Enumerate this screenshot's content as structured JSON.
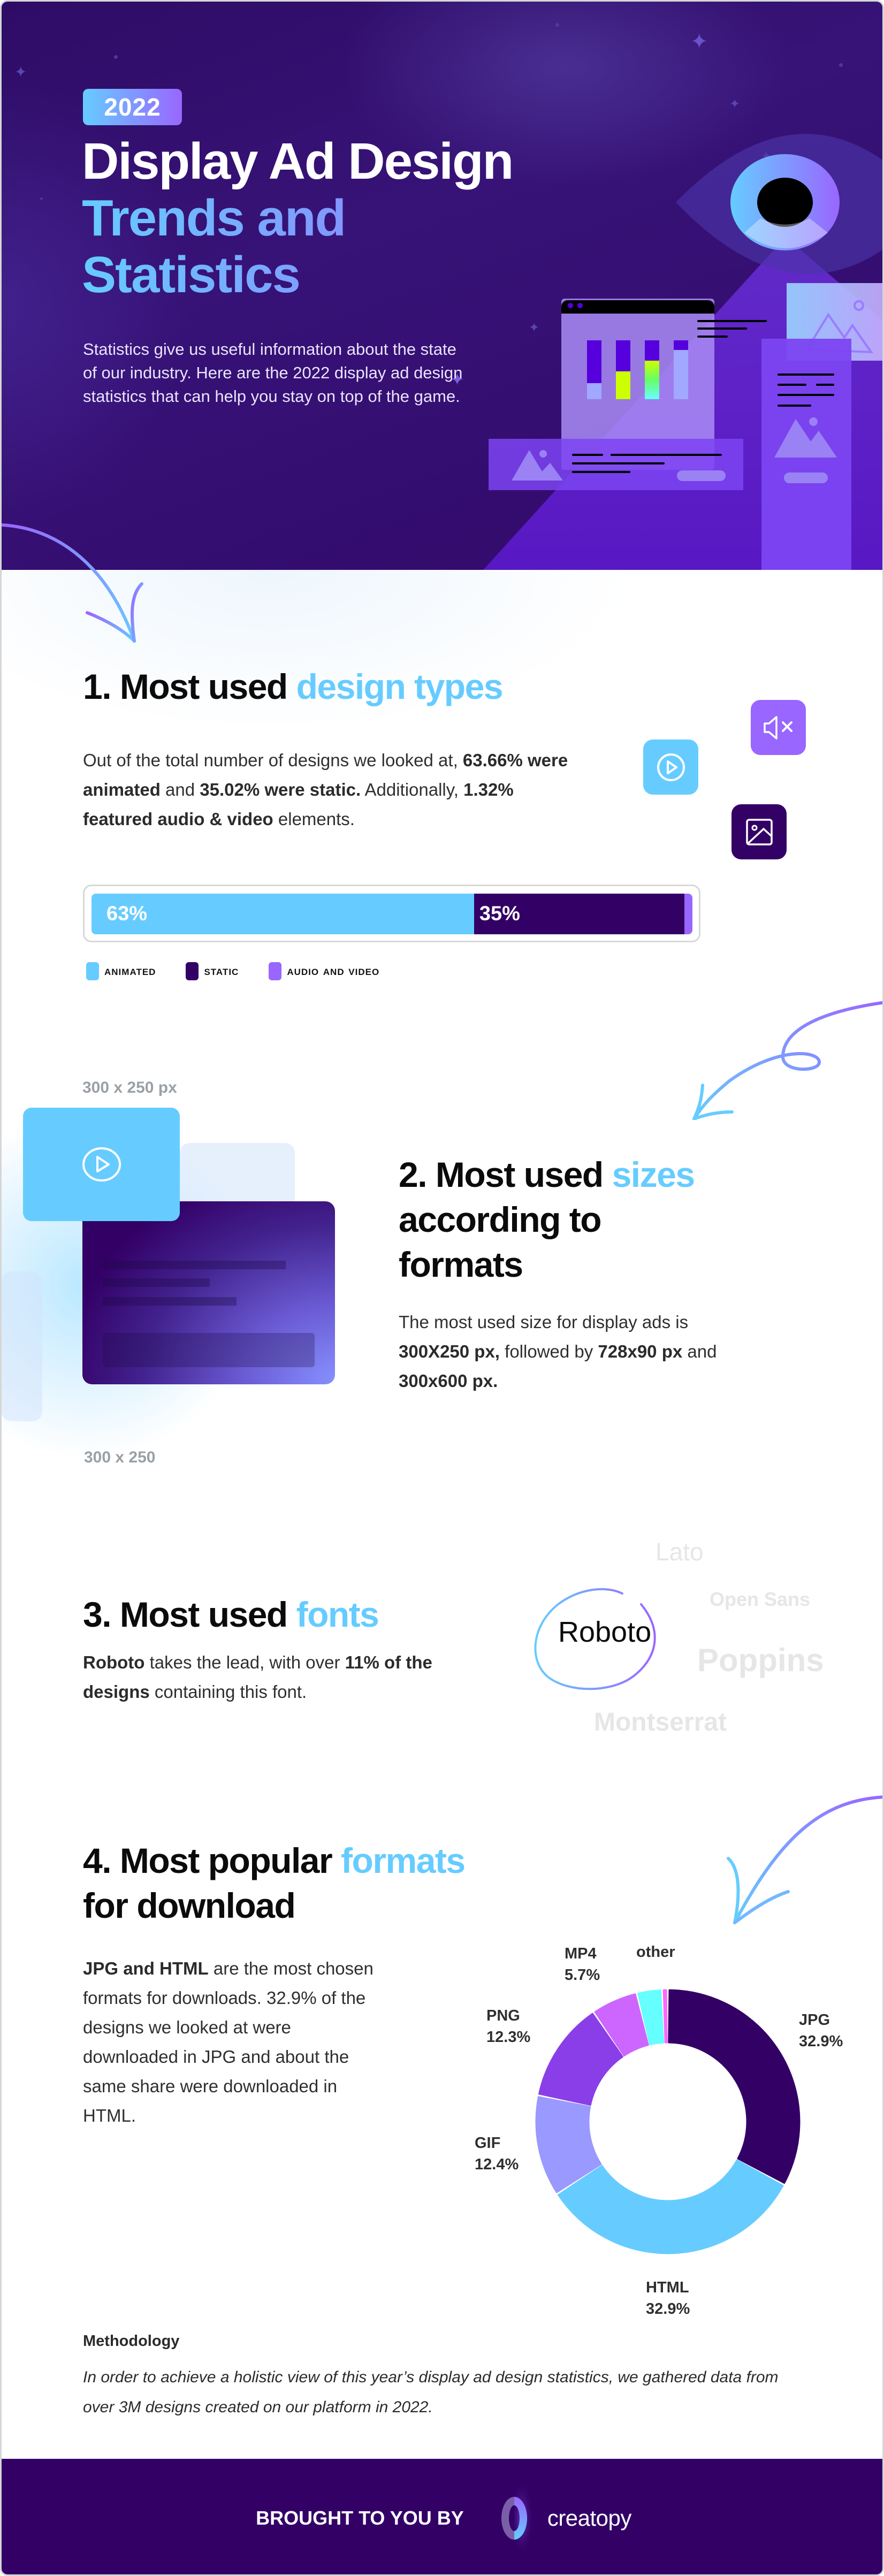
{
  "hero": {
    "badge": "2022",
    "title_line1": "Display Ad Design",
    "title_line2": "Trends and",
    "title_line3": "Statistics",
    "description": "Statistics give us useful information about the state of our industry. Here are the 2022 display ad design statistics that can help you stay on top of the game."
  },
  "section1": {
    "title_number": "1.",
    "title_plain": "Most used",
    "title_accent": "design types",
    "body": [
      {
        "t": "Out of the total number of designs we looked at, ",
        "b": false
      },
      {
        "t": "63.66% were animated",
        "b": true
      },
      {
        "t": " and ",
        "b": false
      },
      {
        "t": "35.02% were static.",
        "b": true
      },
      {
        "t": " Additionally, ",
        "b": false
      },
      {
        "t": "1.32% featured audio & video",
        "b": true
      },
      {
        "t": " elements.",
        "b": false
      }
    ],
    "icons": [
      "play-circle-icon",
      "mute-icon",
      "image-icon"
    ]
  },
  "section2": {
    "title_number": "2.",
    "title_plain": "Most used",
    "title_accent": "sizes",
    "title_rest": "according to formats",
    "label_top": "300 x 250 px",
    "label_bottom": "300 x 250",
    "body": [
      {
        "t": "The most used size for display ads is ",
        "b": false
      },
      {
        "t": "300X250 px,",
        "b": true
      },
      {
        "t": " followed by ",
        "b": false
      },
      {
        "t": "728x90 px",
        "b": true
      },
      {
        "t": " and ",
        "b": false
      },
      {
        "t": "300x600 px.",
        "b": true
      }
    ]
  },
  "section3": {
    "title_number": "3.",
    "title_plain": "Most used",
    "title_accent": "fonts",
    "body": [
      {
        "t": "Roboto",
        "b": true
      },
      {
        "t": " takes the lead, with over ",
        "b": false
      },
      {
        "t": "11% of the designs",
        "b": true
      },
      {
        "t": " containing this font.",
        "b": false
      }
    ],
    "highlight_font": "Roboto",
    "other_fonts": [
      "Lato",
      "Open Sans",
      "Poppins",
      "Montserrat"
    ]
  },
  "section4": {
    "title_number": "4.",
    "title_plain": "Most popular",
    "title_accent": "formats",
    "title_rest": "for download",
    "body": [
      {
        "t": "JPG and HTML",
        "b": true
      },
      {
        "t": " are the most chosen formats for downloads. 32.9% of the designs we looked at were downloaded in JPG and about the same share were downloaded in HTML.",
        "b": false
      }
    ]
  },
  "methodology": {
    "title": "Methodology",
    "body": "In order to achieve a holistic view of this year’s display ad design statistics, we gathered data from over 3M designs created on our platform in 2022."
  },
  "footer": {
    "brought_by": "BROUGHT TO YOU BY",
    "brand": "creatopy"
  },
  "colors": {
    "accent_blue": "#66ccff",
    "deep_purple": "#330066",
    "violet": "#9966ff",
    "hero_bg": "#371377"
  },
  "chart_data": [
    {
      "type": "bar",
      "orientation": "horizontal-stacked",
      "title": "Most used design types",
      "categories": [
        "Animated",
        "Static",
        "Audio and video"
      ],
      "values": [
        63.66,
        35.02,
        1.32
      ],
      "data_labels": [
        "63%",
        "35%",
        ""
      ],
      "legend": [
        "Animated",
        "Static",
        "Audio and video"
      ],
      "legend_placement": "bottom-left",
      "colors": [
        "#66ccff",
        "#330066",
        "#9966ff"
      ],
      "unit": "%"
    },
    {
      "type": "pie",
      "variant": "donut",
      "title": "Most popular formats for download",
      "categories": [
        "JPG",
        "HTML",
        "GIF",
        "PNG",
        "MP4",
        "",
        "other"
      ],
      "values": [
        32.9,
        32.9,
        12.4,
        12.3,
        5.7,
        3.1,
        0.7
      ],
      "labels": [
        {
          "name": "JPG",
          "value": "32.9%"
        },
        {
          "name": "HTML",
          "value": "32.9%"
        },
        {
          "name": "GIF",
          "value": "12.4%"
        },
        {
          "name": "PNG",
          "value": "12.3%"
        },
        {
          "name": "MP4",
          "value": "5.7%"
        },
        {
          "name": "",
          "value": ""
        },
        {
          "name": "other",
          "value": ""
        }
      ],
      "colors": [
        "#330066",
        "#66ccff",
        "#9999ff",
        "#8a3ee8",
        "#cc66ff",
        "#66ffff",
        "#ff66ff"
      ],
      "start": "top, clockwise",
      "unit": "%"
    }
  ]
}
